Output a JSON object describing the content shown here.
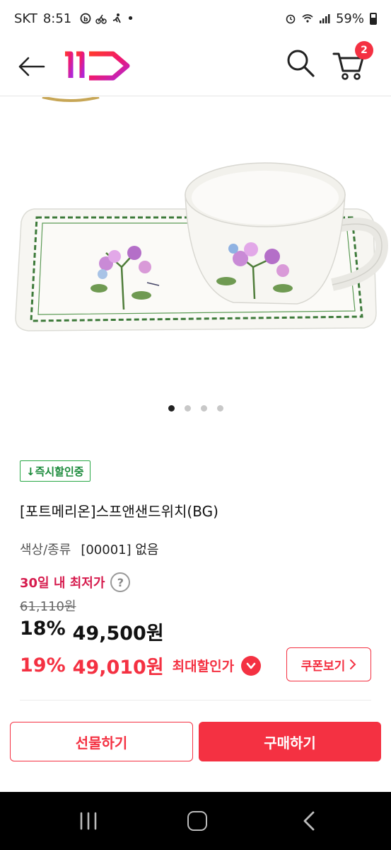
{
  "status_bar": {
    "carrier": "SKT",
    "time": "8:51",
    "dot": "•",
    "battery": "59%"
  },
  "header": {
    "logo_text": "11",
    "cart_count": "2"
  },
  "carousel": {
    "count": 4,
    "active_index": 0
  },
  "product": {
    "badge": "↓즉시할인중",
    "title": "[포트메리온]스프앤샌드위치(BG)",
    "option_label": "색상/종류",
    "option_value": "[00001] 없음",
    "lowest_label": "30일 내 최저가",
    "help_symbol": "?",
    "original_price": "61,110원",
    "sale_rate": "18%",
    "sale_price": "49,500원",
    "max_rate": "19%",
    "max_price": "49,010원",
    "max_label": "최대할인가",
    "coupon_label": "쿠폰보기"
  },
  "actions": {
    "gift_label": "선물하기",
    "buy_label": "구매하기"
  },
  "colors": {
    "accent": "#f43142",
    "badge_green": "#1a8a3a",
    "lowest_red": "#d61c4e"
  }
}
